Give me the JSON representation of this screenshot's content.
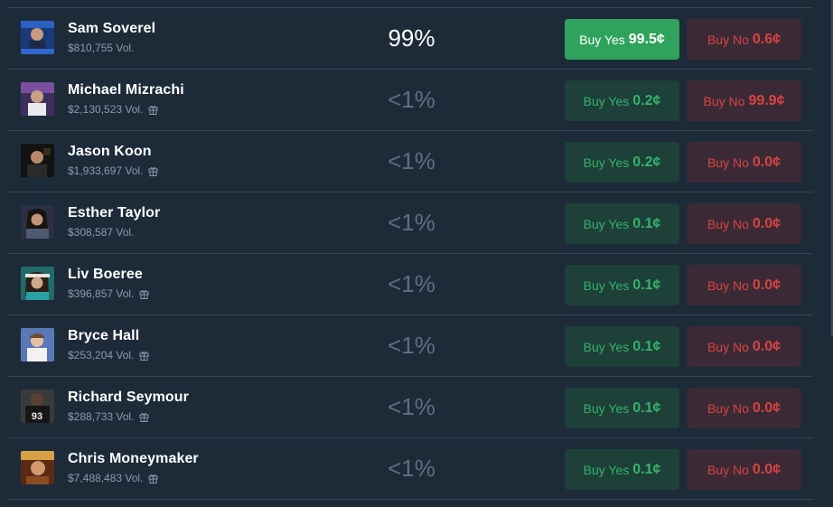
{
  "rows": [
    {
      "name": "Sam Soverel",
      "volume": "$810,755 Vol.",
      "gift": false,
      "percent": "99%",
      "lead": true,
      "yes_label": "Buy Yes",
      "yes_price": "99.5¢",
      "no_label": "Buy No",
      "no_price": "0.6¢"
    },
    {
      "name": "Michael Mizrachi",
      "volume": "$2,130,523 Vol.",
      "gift": true,
      "percent": "<1%",
      "lead": false,
      "yes_label": "Buy Yes",
      "yes_price": "0.2¢",
      "no_label": "Buy No",
      "no_price": "99.9¢"
    },
    {
      "name": "Jason Koon",
      "volume": "$1,933,697 Vol.",
      "gift": true,
      "percent": "<1%",
      "lead": false,
      "yes_label": "Buy Yes",
      "yes_price": "0.2¢",
      "no_label": "Buy No",
      "no_price": "0.0¢"
    },
    {
      "name": "Esther Taylor",
      "volume": "$308,587 Vol.",
      "gift": false,
      "percent": "<1%",
      "lead": false,
      "yes_label": "Buy Yes",
      "yes_price": "0.1¢",
      "no_label": "Buy No",
      "no_price": "0.0¢"
    },
    {
      "name": "Liv Boeree",
      "volume": "$396,857 Vol.",
      "gift": true,
      "percent": "<1%",
      "lead": false,
      "yes_label": "Buy Yes",
      "yes_price": "0.1¢",
      "no_label": "Buy No",
      "no_price": "0.0¢"
    },
    {
      "name": "Bryce Hall",
      "volume": "$253,204 Vol.",
      "gift": true,
      "percent": "<1%",
      "lead": false,
      "yes_label": "Buy Yes",
      "yes_price": "0.1¢",
      "no_label": "Buy No",
      "no_price": "0.0¢"
    },
    {
      "name": "Richard Seymour",
      "volume": "$288,733 Vol.",
      "gift": true,
      "percent": "<1%",
      "lead": false,
      "yes_label": "Buy Yes",
      "yes_price": "0.1¢",
      "no_label": "Buy No",
      "no_price": "0.0¢"
    },
    {
      "name": "Chris Moneymaker",
      "volume": "$7,488,483 Vol.",
      "gift": true,
      "percent": "<1%",
      "lead": false,
      "yes_label": "Buy Yes",
      "yes_price": "0.1¢",
      "no_label": "Buy No",
      "no_price": "0.0¢"
    }
  ],
  "colors": {
    "background": "#1d2b39",
    "divider": "#344454",
    "yes_active": "#2fa35b",
    "yes_idle_bg": "#1d4039",
    "yes_text": "#35b26a",
    "no_bg": "#3b2a36",
    "no_text": "#d94342",
    "muted_percent": "#5e6e7e"
  },
  "icons": {
    "gift": "gift-icon",
    "avatar": "avatar-photo"
  }
}
